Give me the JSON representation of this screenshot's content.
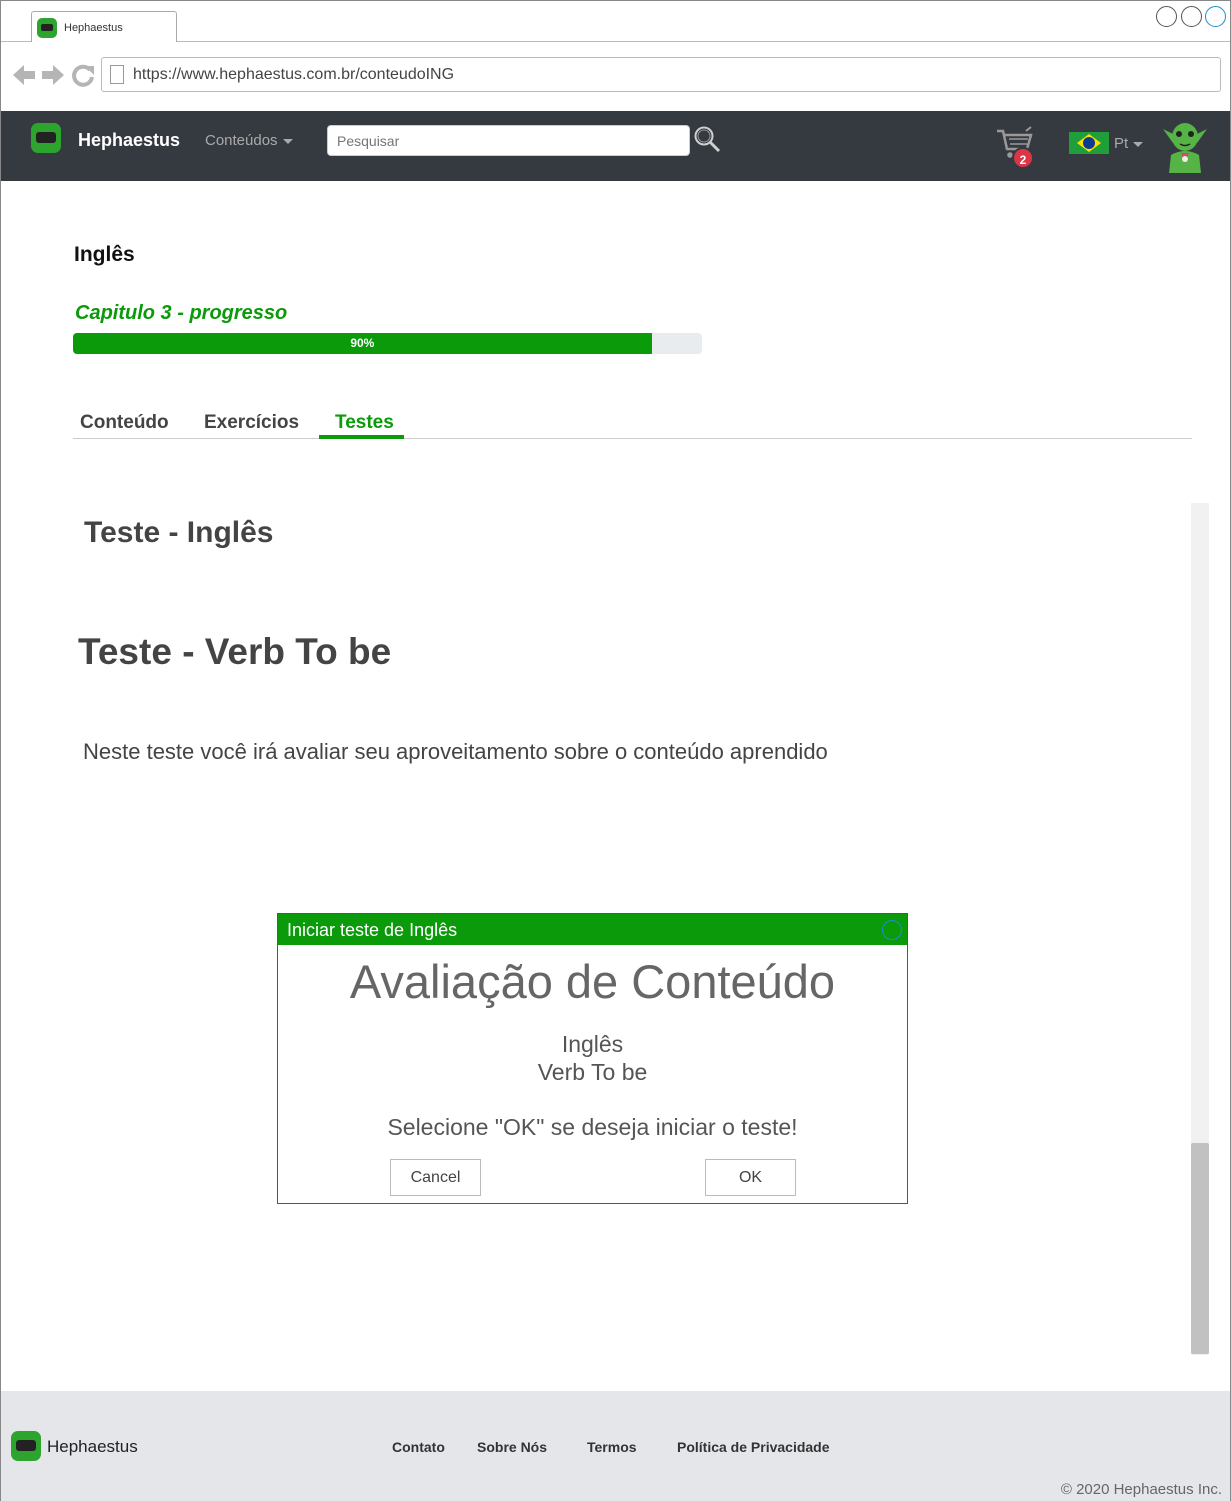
{
  "browser": {
    "tab_title": "Hephaestus",
    "url": "https://www.hephaestus.com.br/conteudoING"
  },
  "navbar": {
    "brand": "Hephaestus",
    "menu_label": "Conteúdos",
    "search_placeholder": "Pesquisar",
    "cart_count": "2",
    "language": "Pt"
  },
  "course": {
    "title": "Inglês",
    "progress_label": "Capitulo 3 - progresso",
    "progress_text": "90%",
    "progress_value": 0.92
  },
  "tabs": [
    {
      "label": "Conteúdo",
      "active": false
    },
    {
      "label": "Exercícios",
      "active": false
    },
    {
      "label": "Testes",
      "active": true
    }
  ],
  "content": {
    "section_title": "Teste - Inglês",
    "test_title": "Teste - Verb To be",
    "description": "Neste teste você irá avaliar seu aproveitamento sobre o conteúdo aprendido"
  },
  "dialog": {
    "title": "Iniciar teste de Inglês",
    "heading": "Avaliação de Conteúdo",
    "subject": "Inglês",
    "topic": "Verb To be",
    "prompt": "Selecione \"OK\" se deseja iniciar o teste!",
    "cancel_label": "Cancel",
    "ok_label": "OK"
  },
  "footer": {
    "brand": "Hephaestus",
    "links": [
      "Contato",
      "Sobre Nós",
      "Termos",
      "Política de Privacidade"
    ],
    "copyright": "© 2020 Hephaestus Inc."
  },
  "colors": {
    "accent": "#0a9a0a",
    "navbar": "#343a40",
    "badge": "#dc3545",
    "footer": "#e4e6ea"
  }
}
